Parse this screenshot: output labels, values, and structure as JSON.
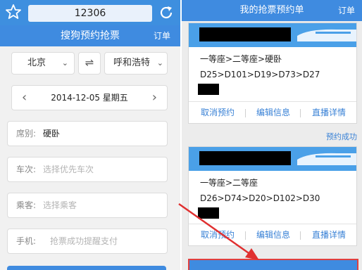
{
  "left": {
    "browser": {
      "url": "12306",
      "star_icon": "star-icon",
      "reload_icon": "reload-icon"
    },
    "header": {
      "title": "搜狗预约抢票",
      "order_link": "订单"
    },
    "from_city": "北京",
    "to_city": "呼和浩特",
    "swap_icon": "swap-arrows-icon",
    "date": {
      "prev": "‹",
      "text": "2014-12-05 星期五",
      "next": "›"
    },
    "fields": {
      "seat_label": "席别:",
      "seat_value": "硬卧",
      "train_label": "车次:",
      "train_placeholder": "选择优先车次",
      "passenger_label": "乘客:",
      "passenger_placeholder": "选择乘客",
      "phone_label": "手机:",
      "phone_placeholder": "抢票成功提醒支付"
    }
  },
  "right": {
    "header": {
      "title": "我的抢票预约单",
      "order_link": "订单"
    },
    "cards": [
      {
        "seats": "一等座>二等座>硬卧",
        "trains": "D25>D101>D19>D73>D27",
        "actions": [
          "取消预约",
          "编辑信息",
          "直播详情"
        ]
      },
      {
        "seats": "一等座>二等座",
        "trains": "D26>D74>D20>D102>D30",
        "actions": [
          "取消预约",
          "编辑信息",
          "直播详情"
        ]
      }
    ],
    "status": "预约成功"
  },
  "colors": {
    "primary_blue": "#3f8be0",
    "link_blue": "#3a82d6",
    "annotation_red": "#e03030"
  }
}
